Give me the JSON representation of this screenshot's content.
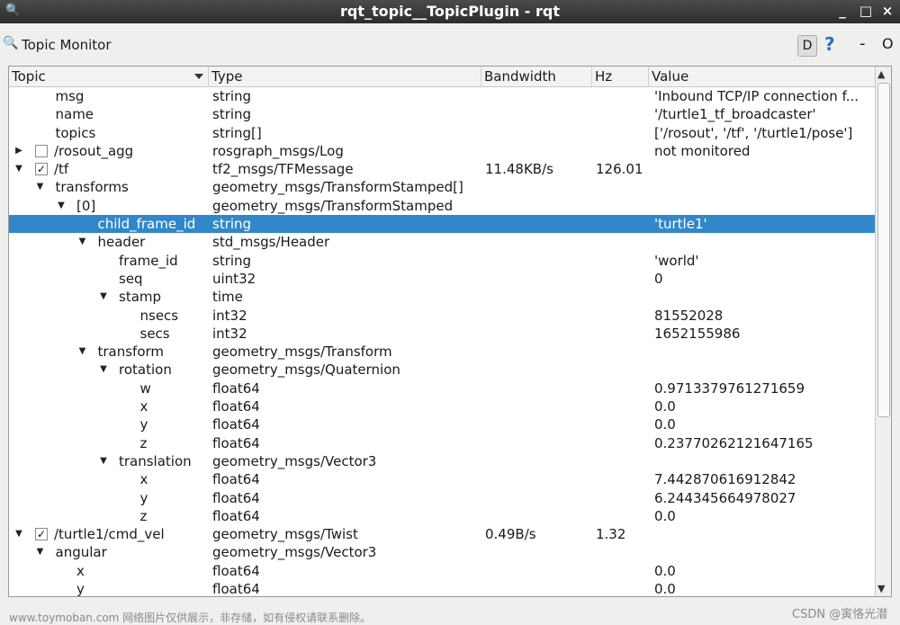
{
  "window": {
    "title": "rqt_topic__TopicPlugin - rqt",
    "min_label": "_",
    "max_label": "□",
    "close_label": "×"
  },
  "panel": {
    "title": "Topic Monitor",
    "d_label": "D",
    "help_label": "?",
    "min_label": "-",
    "close_label": "O"
  },
  "columns": {
    "topic": "Topic",
    "type": "Type",
    "bandwidth": "Bandwidth",
    "hz": "Hz",
    "value": "Value"
  },
  "rows": [
    {
      "name": "msg",
      "type": "string",
      "bw": "",
      "hz": "",
      "value": "'Inbound TCP/IP connection f...",
      "indent": 1,
      "expander": "",
      "checkbox": null,
      "selected": false
    },
    {
      "name": "name",
      "type": "string",
      "bw": "",
      "hz": "",
      "value": "'/turtle1_tf_broadcaster'",
      "indent": 1,
      "expander": "",
      "checkbox": null,
      "selected": false
    },
    {
      "name": "topics",
      "type": "string[]",
      "bw": "",
      "hz": "",
      "value": "['/rosout', '/tf', '/turtle1/pose']",
      "indent": 1,
      "expander": "",
      "checkbox": null,
      "selected": false
    },
    {
      "name": "/rosout_agg",
      "type": "rosgraph_msgs/Log",
      "bw": "",
      "hz": "",
      "value": "not monitored",
      "indent": 0,
      "expander": "collapsed",
      "checkbox": false,
      "selected": false
    },
    {
      "name": "/tf",
      "type": "tf2_msgs/TFMessage",
      "bw": "11.48KB/s",
      "hz": "126.01",
      "value": "",
      "indent": 0,
      "expander": "expanded",
      "checkbox": true,
      "selected": false
    },
    {
      "name": "transforms",
      "type": "geometry_msgs/TransformStamped[]",
      "bw": "",
      "hz": "",
      "value": "",
      "indent": 1,
      "expander": "expanded",
      "checkbox": null,
      "selected": false
    },
    {
      "name": "[0]",
      "type": "geometry_msgs/TransformStamped",
      "bw": "",
      "hz": "",
      "value": "",
      "indent": 2,
      "expander": "expanded",
      "checkbox": null,
      "selected": false
    },
    {
      "name": "child_frame_id",
      "type": "string",
      "bw": "",
      "hz": "",
      "value": "'turtle1'",
      "indent": 3,
      "expander": "",
      "checkbox": null,
      "selected": true
    },
    {
      "name": "header",
      "type": "std_msgs/Header",
      "bw": "",
      "hz": "",
      "value": "",
      "indent": 3,
      "expander": "expanded",
      "checkbox": null,
      "selected": false
    },
    {
      "name": "frame_id",
      "type": "string",
      "bw": "",
      "hz": "",
      "value": "'world'",
      "indent": 4,
      "expander": "",
      "checkbox": null,
      "selected": false
    },
    {
      "name": "seq",
      "type": "uint32",
      "bw": "",
      "hz": "",
      "value": "0",
      "indent": 4,
      "expander": "",
      "checkbox": null,
      "selected": false
    },
    {
      "name": "stamp",
      "type": "time",
      "bw": "",
      "hz": "",
      "value": "",
      "indent": 4,
      "expander": "expanded",
      "checkbox": null,
      "selected": false
    },
    {
      "name": "nsecs",
      "type": "int32",
      "bw": "",
      "hz": "",
      "value": "81552028",
      "indent": 5,
      "expander": "",
      "checkbox": null,
      "selected": false
    },
    {
      "name": "secs",
      "type": "int32",
      "bw": "",
      "hz": "",
      "value": "1652155986",
      "indent": 5,
      "expander": "",
      "checkbox": null,
      "selected": false
    },
    {
      "name": "transform",
      "type": "geometry_msgs/Transform",
      "bw": "",
      "hz": "",
      "value": "",
      "indent": 3,
      "expander": "expanded",
      "checkbox": null,
      "selected": false
    },
    {
      "name": "rotation",
      "type": "geometry_msgs/Quaternion",
      "bw": "",
      "hz": "",
      "value": "",
      "indent": 4,
      "expander": "expanded",
      "checkbox": null,
      "selected": false
    },
    {
      "name": "w",
      "type": "float64",
      "bw": "",
      "hz": "",
      "value": "0.9713379761271659",
      "indent": 5,
      "expander": "",
      "checkbox": null,
      "selected": false
    },
    {
      "name": "x",
      "type": "float64",
      "bw": "",
      "hz": "",
      "value": "0.0",
      "indent": 5,
      "expander": "",
      "checkbox": null,
      "selected": false
    },
    {
      "name": "y",
      "type": "float64",
      "bw": "",
      "hz": "",
      "value": "0.0",
      "indent": 5,
      "expander": "",
      "checkbox": null,
      "selected": false
    },
    {
      "name": "z",
      "type": "float64",
      "bw": "",
      "hz": "",
      "value": "0.23770262121647165",
      "indent": 5,
      "expander": "",
      "checkbox": null,
      "selected": false
    },
    {
      "name": "translation",
      "type": "geometry_msgs/Vector3",
      "bw": "",
      "hz": "",
      "value": "",
      "indent": 4,
      "expander": "expanded",
      "checkbox": null,
      "selected": false
    },
    {
      "name": "x",
      "type": "float64",
      "bw": "",
      "hz": "",
      "value": "7.442870616912842",
      "indent": 5,
      "expander": "",
      "checkbox": null,
      "selected": false
    },
    {
      "name": "y",
      "type": "float64",
      "bw": "",
      "hz": "",
      "value": "6.244345664978027",
      "indent": 5,
      "expander": "",
      "checkbox": null,
      "selected": false
    },
    {
      "name": "z",
      "type": "float64",
      "bw": "",
      "hz": "",
      "value": "0.0",
      "indent": 5,
      "expander": "",
      "checkbox": null,
      "selected": false
    },
    {
      "name": "/turtle1/cmd_vel",
      "type": "geometry_msgs/Twist",
      "bw": "0.49B/s",
      "hz": "1.32",
      "value": "",
      "indent": 0,
      "expander": "expanded",
      "checkbox": true,
      "selected": false
    },
    {
      "name": "angular",
      "type": "geometry_msgs/Vector3",
      "bw": "",
      "hz": "",
      "value": "",
      "indent": 1,
      "expander": "expanded",
      "checkbox": null,
      "selected": false
    },
    {
      "name": "x",
      "type": "float64",
      "bw": "",
      "hz": "",
      "value": "0.0",
      "indent": 2,
      "expander": "",
      "checkbox": null,
      "selected": false
    },
    {
      "name": "y",
      "type": "float64",
      "bw": "",
      "hz": "",
      "value": "0.0",
      "indent": 2,
      "expander": "",
      "checkbox": null,
      "selected": false
    }
  ],
  "watermark": "www.toymoban.com 网络图片仅供展示，非存储，如有侵权请联系删除。",
  "watermark_right": "CSDN @寅恪光潜",
  "icons": {
    "title": "magnifier-icon",
    "panel": "magnifier-icon"
  },
  "colors": {
    "selection": "#3287c8",
    "help": "#2a6fc4"
  }
}
